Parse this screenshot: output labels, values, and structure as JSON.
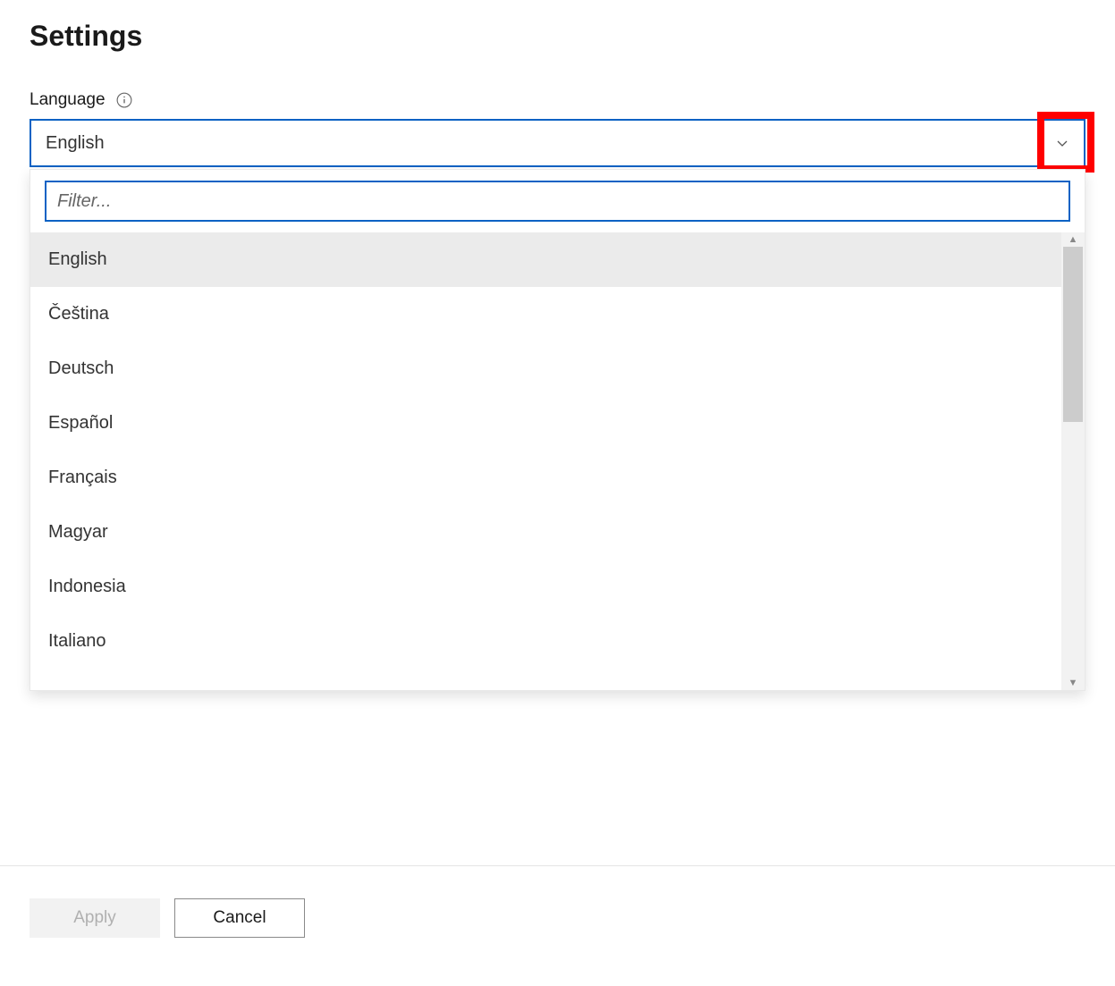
{
  "page": {
    "title": "Settings"
  },
  "language": {
    "label": "Language",
    "selected": "English",
    "filter_placeholder": "Filter...",
    "options": [
      "English",
      "Čeština",
      "Deutsch",
      "Español",
      "Français",
      "Magyar",
      "Indonesia",
      "Italiano"
    ]
  },
  "footer": {
    "apply_label": "Apply",
    "cancel_label": "Cancel"
  }
}
